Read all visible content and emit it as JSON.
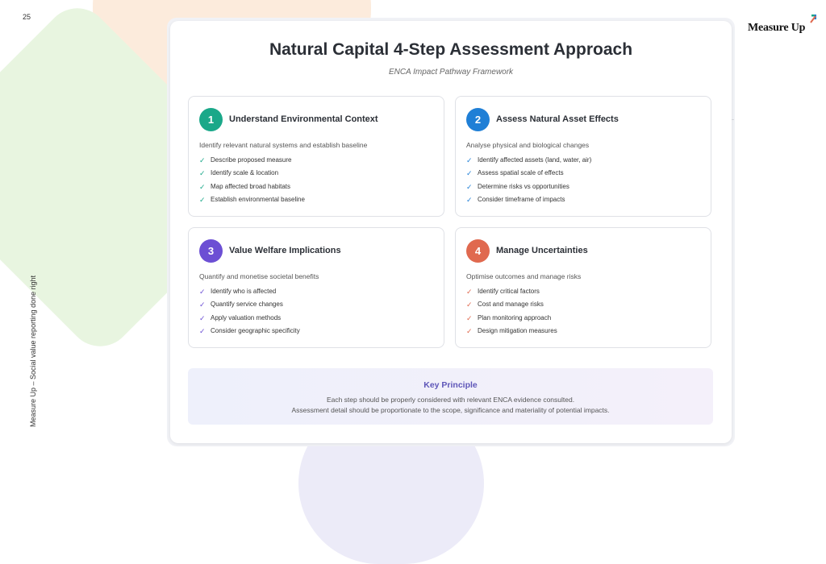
{
  "slide": {
    "page_number": "25",
    "side_text": "Measure Up – Social value reporting done right",
    "logo_text": "Measure Up"
  },
  "colors": {
    "step1": "#1aa889",
    "step2": "#1f7fd6",
    "step3": "#6c4fd4",
    "step4": "#e0694f",
    "principle_title": "#5e56b8"
  },
  "header": {
    "title": "Natural Capital 4-Step Assessment Approach",
    "subtitle": "ENCA Impact Pathway Framework"
  },
  "steps": [
    {
      "number": "1",
      "title": "Understand Environmental Context",
      "description": "Identify relevant natural systems and establish baseline",
      "items": [
        "Describe proposed measure",
        "Identify scale & location",
        "Map affected broad habitats",
        "Establish environmental baseline"
      ]
    },
    {
      "number": "2",
      "title": "Assess Natural Asset Effects",
      "description": "Analyse physical and biological changes",
      "items": [
        "Identify affected assets (land, water, air)",
        "Assess spatial scale of effects",
        "Determine risks vs opportunities",
        "Consider timeframe of impacts"
      ]
    },
    {
      "number": "3",
      "title": "Value Welfare Implications",
      "description": "Quantify and monetise societal benefits",
      "items": [
        "Identify who is affected",
        "Quantify service changes",
        "Apply valuation methods",
        "Consider geographic specificity"
      ]
    },
    {
      "number": "4",
      "title": "Manage Uncertainties",
      "description": "Optimise outcomes and manage risks",
      "items": [
        "Identify critical factors",
        "Cost and manage risks",
        "Plan monitoring approach",
        "Design mitigation measures"
      ]
    }
  ],
  "check_glyph": "✓",
  "principle": {
    "title": "Key Principle",
    "line1": "Each step should be properly considered with relevant ENCA evidence consulted.",
    "line2": "Assessment detail should be proportionate to the scope, significance and materiality of potential impacts."
  }
}
